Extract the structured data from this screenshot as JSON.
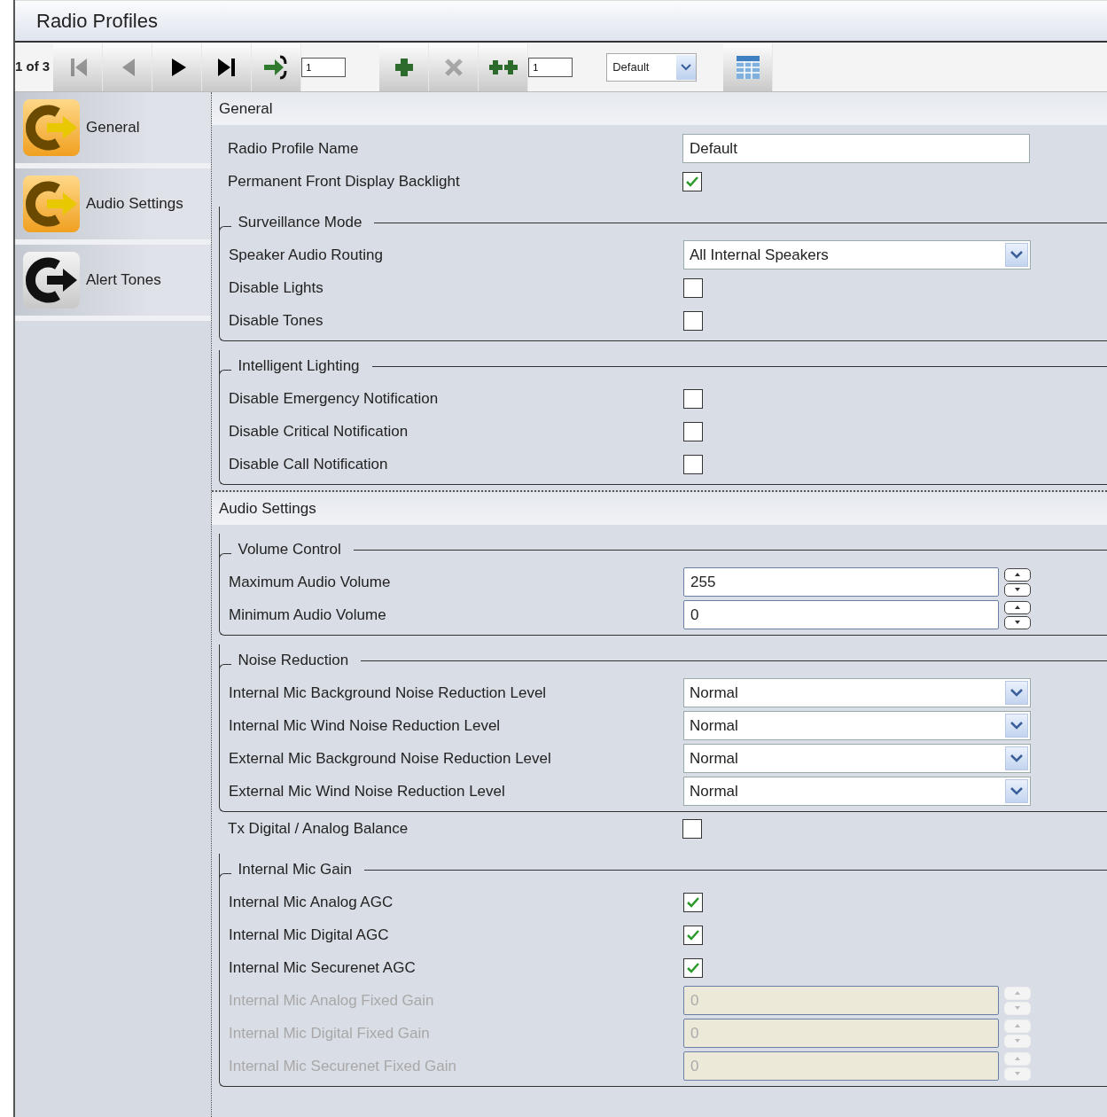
{
  "window": {
    "title": "Radio Profiles"
  },
  "toolbar": {
    "counter": "1 of 3",
    "items": [
      {
        "kind": "button",
        "disabled": true
      },
      {
        "kind": "button",
        "disabled": true
      },
      {
        "kind": "button",
        "disabled": false
      },
      {
        "kind": "button",
        "disabled": false
      },
      {
        "kind": "button",
        "disabled": false
      },
      {
        "kind": "field",
        "value": "1"
      },
      {
        "kind": "gap"
      },
      {
        "kind": "button",
        "disabled": false
      },
      {
        "kind": "button",
        "disabled": true
      },
      {
        "kind": "button",
        "disabled": false
      },
      {
        "kind": "field",
        "value": "1"
      },
      {
        "kind": "gap"
      },
      {
        "kind": "select",
        "value": "Default"
      },
      {
        "kind": "gap"
      },
      {
        "kind": "button",
        "disabled": false
      }
    ]
  },
  "sidebar": {
    "items": [
      {
        "label": "General",
        "selected": true
      },
      {
        "label": "Audio Settings",
        "selected": true
      },
      {
        "label": "Alert Tones",
        "selected": false
      }
    ]
  },
  "sections": [
    {
      "title": "General",
      "blocks": [
        {
          "kind": "plain",
          "rows": [
            {
              "kind": "text",
              "label": "Radio Profile Name",
              "value": "Default",
              "disabled": false
            },
            {
              "kind": "check",
              "label": "Permanent Front Display Backlight",
              "checked": true,
              "disabled": false
            }
          ]
        },
        {
          "kind": "group",
          "title": "Surveillance  Mode",
          "rows": [
            {
              "kind": "select",
              "label": "Speaker Audio Routing",
              "value": "All Internal Speakers",
              "disabled": false
            },
            {
              "kind": "check",
              "label": "Disable Lights",
              "checked": false,
              "disabled": false
            },
            {
              "kind": "check",
              "label": "Disable Tones",
              "checked": false,
              "disabled": false
            }
          ]
        },
        {
          "kind": "group",
          "title": "Intelligent Lighting",
          "rows": [
            {
              "kind": "check",
              "label": "Disable Emergency Notification",
              "checked": false,
              "disabled": false
            },
            {
              "kind": "check",
              "label": "Disable Critical Notification",
              "checked": false,
              "disabled": false
            },
            {
              "kind": "check",
              "label": "Disable Call Notification",
              "checked": false,
              "disabled": false
            }
          ]
        }
      ]
    },
    {
      "title": "Audio Settings",
      "blocks": [
        {
          "kind": "group",
          "title": "Volume Control",
          "rows": [
            {
              "kind": "spin",
              "label": "Maximum Audio Volume",
              "value": "255",
              "disabled": false
            },
            {
              "kind": "spin",
              "label": "Minimum Audio Volume",
              "value": "0",
              "disabled": false
            }
          ]
        },
        {
          "kind": "group",
          "title": "Noise Reduction",
          "rows": [
            {
              "kind": "select",
              "label": "Internal Mic Background Noise Reduction Level",
              "value": "Normal",
              "disabled": false
            },
            {
              "kind": "select",
              "label": "Internal Mic Wind Noise Reduction Level",
              "value": "Normal",
              "disabled": false
            },
            {
              "kind": "select",
              "label": "External Mic Background Noise Reduction Level",
              "value": "Normal",
              "disabled": false
            },
            {
              "kind": "select",
              "label": "External Mic Wind Noise Reduction Level",
              "value": "Normal",
              "disabled": false
            }
          ]
        },
        {
          "kind": "plain",
          "rows": [
            {
              "kind": "check",
              "label": "Tx Digital / Analog Balance",
              "checked": false,
              "disabled": false
            }
          ]
        },
        {
          "kind": "group",
          "title": "Internal Mic Gain",
          "rows": [
            {
              "kind": "check",
              "label": "Internal Mic Analog AGC",
              "checked": true,
              "disabled": false
            },
            {
              "kind": "check",
              "label": "Internal Mic Digital AGC",
              "checked": true,
              "disabled": false
            },
            {
              "kind": "check",
              "label": "Internal Mic Securenet AGC",
              "checked": true,
              "disabled": false
            },
            {
              "kind": "spin",
              "label": "Internal Mic Analog Fixed Gain",
              "value": "0",
              "disabled": true
            },
            {
              "kind": "spin",
              "label": "Internal Mic Digital Fixed Gain",
              "value": "0",
              "disabled": true
            },
            {
              "kind": "spin",
              "label": "Internal Mic Securenet Fixed Gain",
              "value": "0",
              "disabled": true
            }
          ]
        }
      ]
    }
  ]
}
